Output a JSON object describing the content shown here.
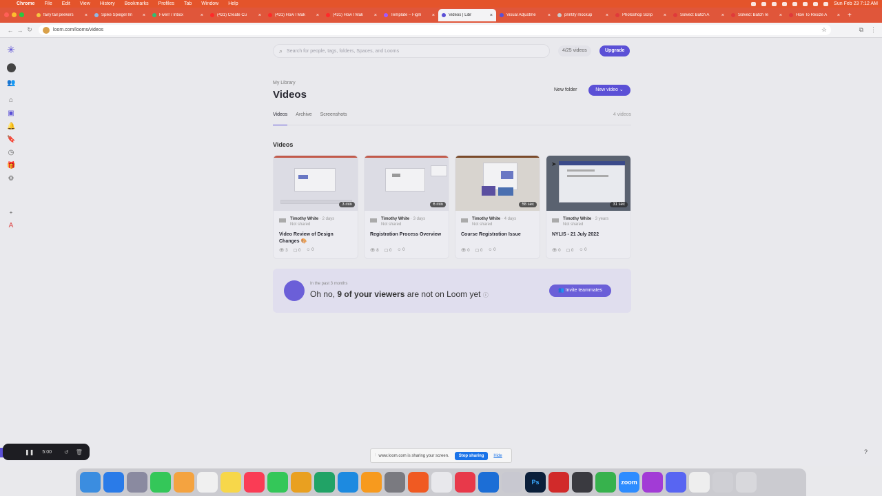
{
  "menubar": {
    "app": "Chrome",
    "items": [
      "File",
      "Edit",
      "View",
      "History",
      "Bookmarks",
      "Profiles",
      "Tab",
      "Window",
      "Help"
    ],
    "datetime": "Sun Feb 23  7:12 AM"
  },
  "tabs": [
    {
      "label": "fairy tail peekers",
      "color": "#f5c542"
    },
    {
      "label": "Spike Spiegel Im",
      "color": "#8fb8e6"
    },
    {
      "label": "Fiverr / Inbox",
      "color": "#2fbf71"
    },
    {
      "label": "(431) Create Cu",
      "color": "#ff2a2a"
    },
    {
      "label": "(431) How I Mak",
      "color": "#ff2a2a"
    },
    {
      "label": "(431) How I Mak",
      "color": "#ff2a2a"
    },
    {
      "label": "Template – Figm",
      "color": "#a259ff"
    },
    {
      "label": "Videos | Libr",
      "color": "#5b50d6",
      "active": true
    },
    {
      "label": "Visual Adjustme",
      "color": "#5b50d6"
    },
    {
      "label": "printify mockup",
      "color": "#cccccc"
    },
    {
      "label": "Photoshop Scrip",
      "color": "#e03a3a"
    },
    {
      "label": "Solved: Batch A",
      "color": "#e03a3a"
    },
    {
      "label": "Solved: Batch re",
      "color": "#e03a3a"
    },
    {
      "label": "How To Resize A",
      "color": "#e03a3a"
    }
  ],
  "address": {
    "url": "loom.com/looms/videos"
  },
  "loom": {
    "search_placeholder": "Search for people, tags, folders, Spaces, and Looms",
    "video_count": "4/25 videos",
    "upgrade_label": "Upgrade",
    "breadcrumb": "My Library",
    "page_title": "Videos",
    "new_folder_label": "New folder",
    "new_video_label": "New video",
    "tabs": [
      "Videos",
      "Archive",
      "Screenshots"
    ],
    "total_videos": "4 videos",
    "section_title": "Videos",
    "cards": [
      {
        "duration": "3 min",
        "author": "Timothy White",
        "ago": "· 2 days",
        "shared": "Not shared",
        "title": "Video Review of Design Changes 🎨",
        "views": "3",
        "comments": "0",
        "reactions": "0"
      },
      {
        "duration": "6 min",
        "author": "Timothy White",
        "ago": "· 3 days",
        "shared": "Not shared",
        "title": "Registration Process Overview",
        "views": "8",
        "comments": "0",
        "reactions": "0"
      },
      {
        "duration": "58 sec",
        "author": "Timothy White",
        "ago": "· 4 days",
        "shared": "Not shared",
        "title": "Course Registration Issue",
        "views": "0",
        "comments": "0",
        "reactions": "0"
      },
      {
        "duration": "31 sec",
        "author": "Timothy White",
        "ago": "· 3 years",
        "shared": "Not shared",
        "title": "NYLIS - 21 July 2022",
        "views": "0",
        "comments": "0",
        "reactions": "0"
      }
    ],
    "banner": {
      "small": "In the past 3 months",
      "prefix": "Oh no, ",
      "highlight": "9 of your viewers",
      "suffix": " are not on Loom yet",
      "invite_label": "Invite teammates"
    }
  },
  "recorder": {
    "time": "5:00"
  },
  "share_bar": {
    "message": "www.loom.com is sharing your screen.",
    "stop_label": "Stop sharing",
    "hide_label": "Hide"
  },
  "colors": {
    "accent": "#5b50d6",
    "menubar": "#e4542b"
  }
}
